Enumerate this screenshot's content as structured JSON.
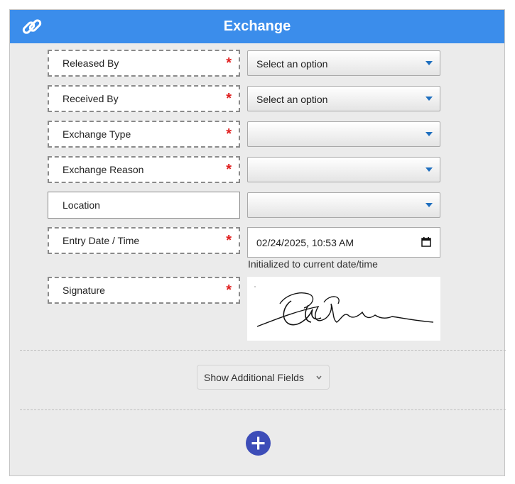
{
  "header": {
    "title": "Exchange",
    "icon": "link-icon"
  },
  "fields": [
    {
      "label": "Released By",
      "required": "*",
      "value": "Select an option"
    },
    {
      "label": "Received By",
      "required": "*",
      "value": "Select an option"
    },
    {
      "label": "Exchange Type",
      "required": "*",
      "value": ""
    },
    {
      "label": "Exchange Reason",
      "required": "*",
      "value": ""
    },
    {
      "label": "Location",
      "required": "",
      "value": ""
    }
  ],
  "entry_date": {
    "label": "Entry Date / Time",
    "required": "*",
    "value": "02/24/2025, 10:53 AM",
    "hint": "Initialized to current date/time"
  },
  "signature": {
    "label": "Signature",
    "required": "*"
  },
  "more_button": {
    "label": "Show Additional Fields"
  },
  "colors": {
    "header": "#3b8deb",
    "required": "#e02020",
    "add_button": "#3d4db8",
    "caret": "#1f6fbf"
  }
}
